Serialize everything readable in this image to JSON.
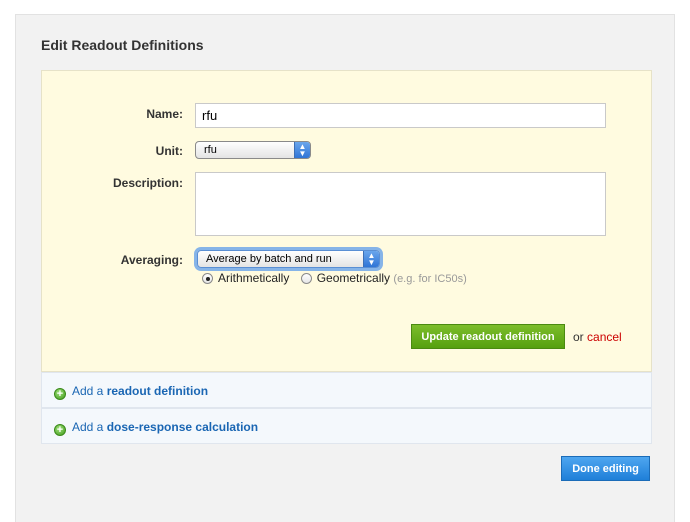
{
  "panel": {
    "title": "Edit Readout Definitions"
  },
  "form": {
    "name_label": "Name:",
    "name_value": "rfu",
    "unit_label": "Unit:",
    "unit_value": "rfu",
    "description_label": "Description:",
    "description_value": "",
    "averaging_label": "Averaging:",
    "averaging_value": "Average by batch and run",
    "radio_arith": "Arithmetically",
    "radio_geo": "Geometrically",
    "radio_geo_hint": "(e.g. for IC50s)",
    "update_button": "Update readout definition",
    "or_text": "or",
    "cancel_link": "cancel"
  },
  "add_readout": {
    "prefix": "Add a",
    "link": "readout definition"
  },
  "add_dose": {
    "prefix": "Add a",
    "link": "dose-response calculation"
  },
  "done_button": "Done editing",
  "colors": {
    "green": "#56a00f",
    "blue": "#1f7fd8",
    "cancel": "#cc0000",
    "form_bg": "#fffbe0"
  }
}
